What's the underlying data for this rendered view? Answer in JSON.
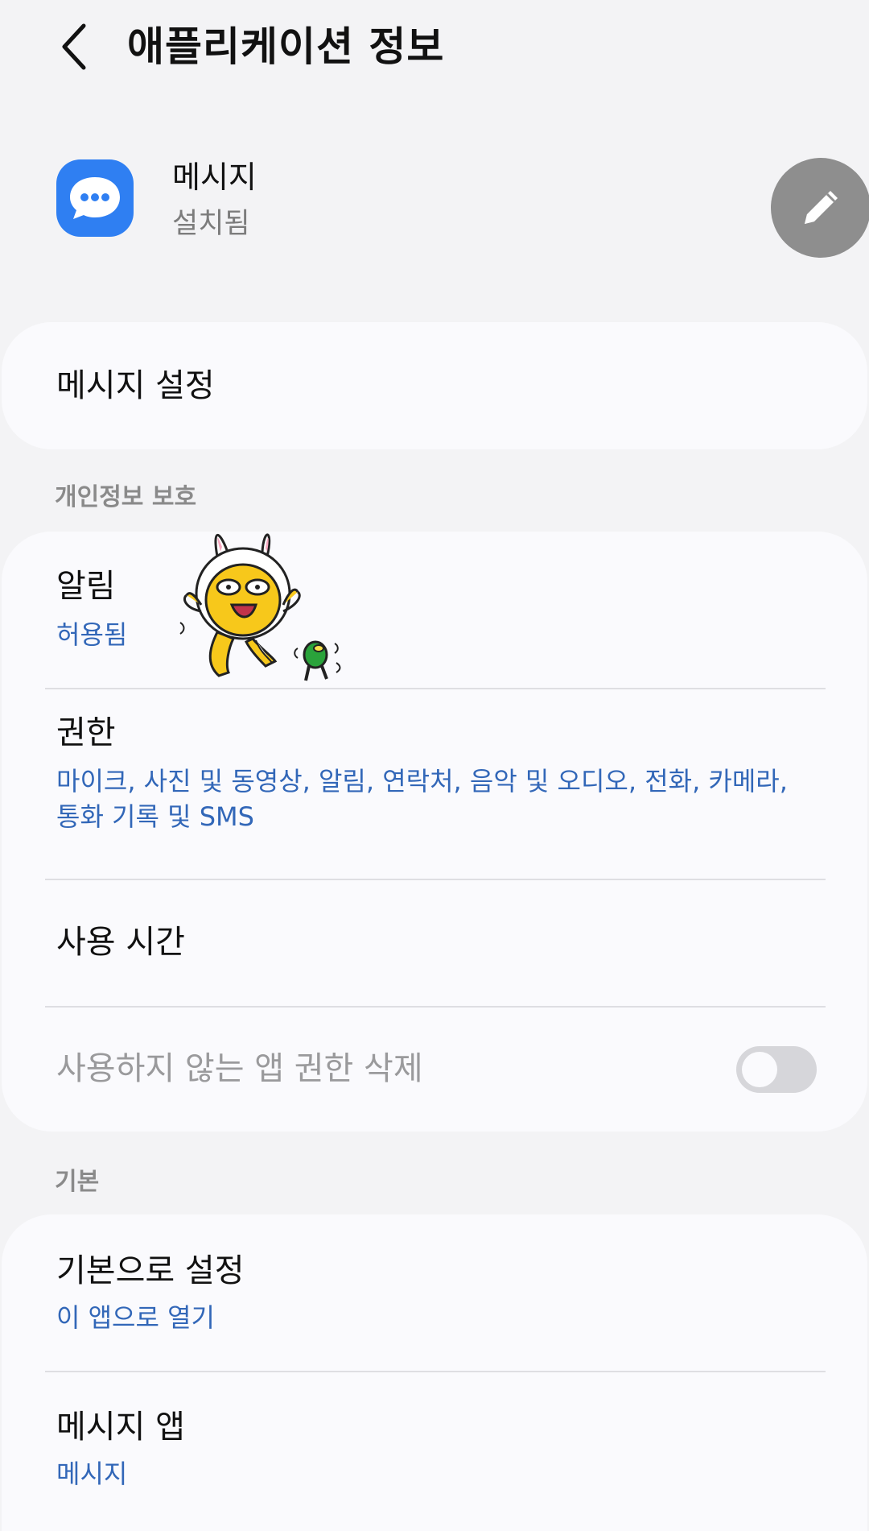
{
  "header": {
    "title": "애플리케이션 정보",
    "back_icon": "chevron-left-icon"
  },
  "app": {
    "name": "메시지",
    "status": "설치됨",
    "icon": "message-bubble-icon",
    "edit_icon": "pencil-icon",
    "icon_color": "#2f7ff2"
  },
  "settings_card": {
    "label": "메시지 설정"
  },
  "privacy": {
    "section_label": "개인정보 보호",
    "notifications": {
      "title": "알림",
      "sub": "허용됨"
    },
    "permissions": {
      "title": "권한",
      "sub_line1": "마이크, 사진 및 동영상, 알림, 연락처, 음악 및 오디오, 전화, 카메라,",
      "sub_line2": "통화 기록 및 SMS"
    },
    "usage_time": {
      "title": "사용 시간"
    },
    "remove_permissions": {
      "title": "사용하지 않는 앱 권한 삭제",
      "toggle_state": "off"
    }
  },
  "defaults": {
    "section_label": "기본",
    "set_default": {
      "title": "기본으로 설정",
      "sub": "이 앱으로 열기"
    },
    "messaging_app": {
      "title": "메시지 앱",
      "sub": "메시지"
    }
  },
  "colors": {
    "accent_text": "#3267b8",
    "background": "#f3f3f5",
    "card": "#fafafd"
  }
}
